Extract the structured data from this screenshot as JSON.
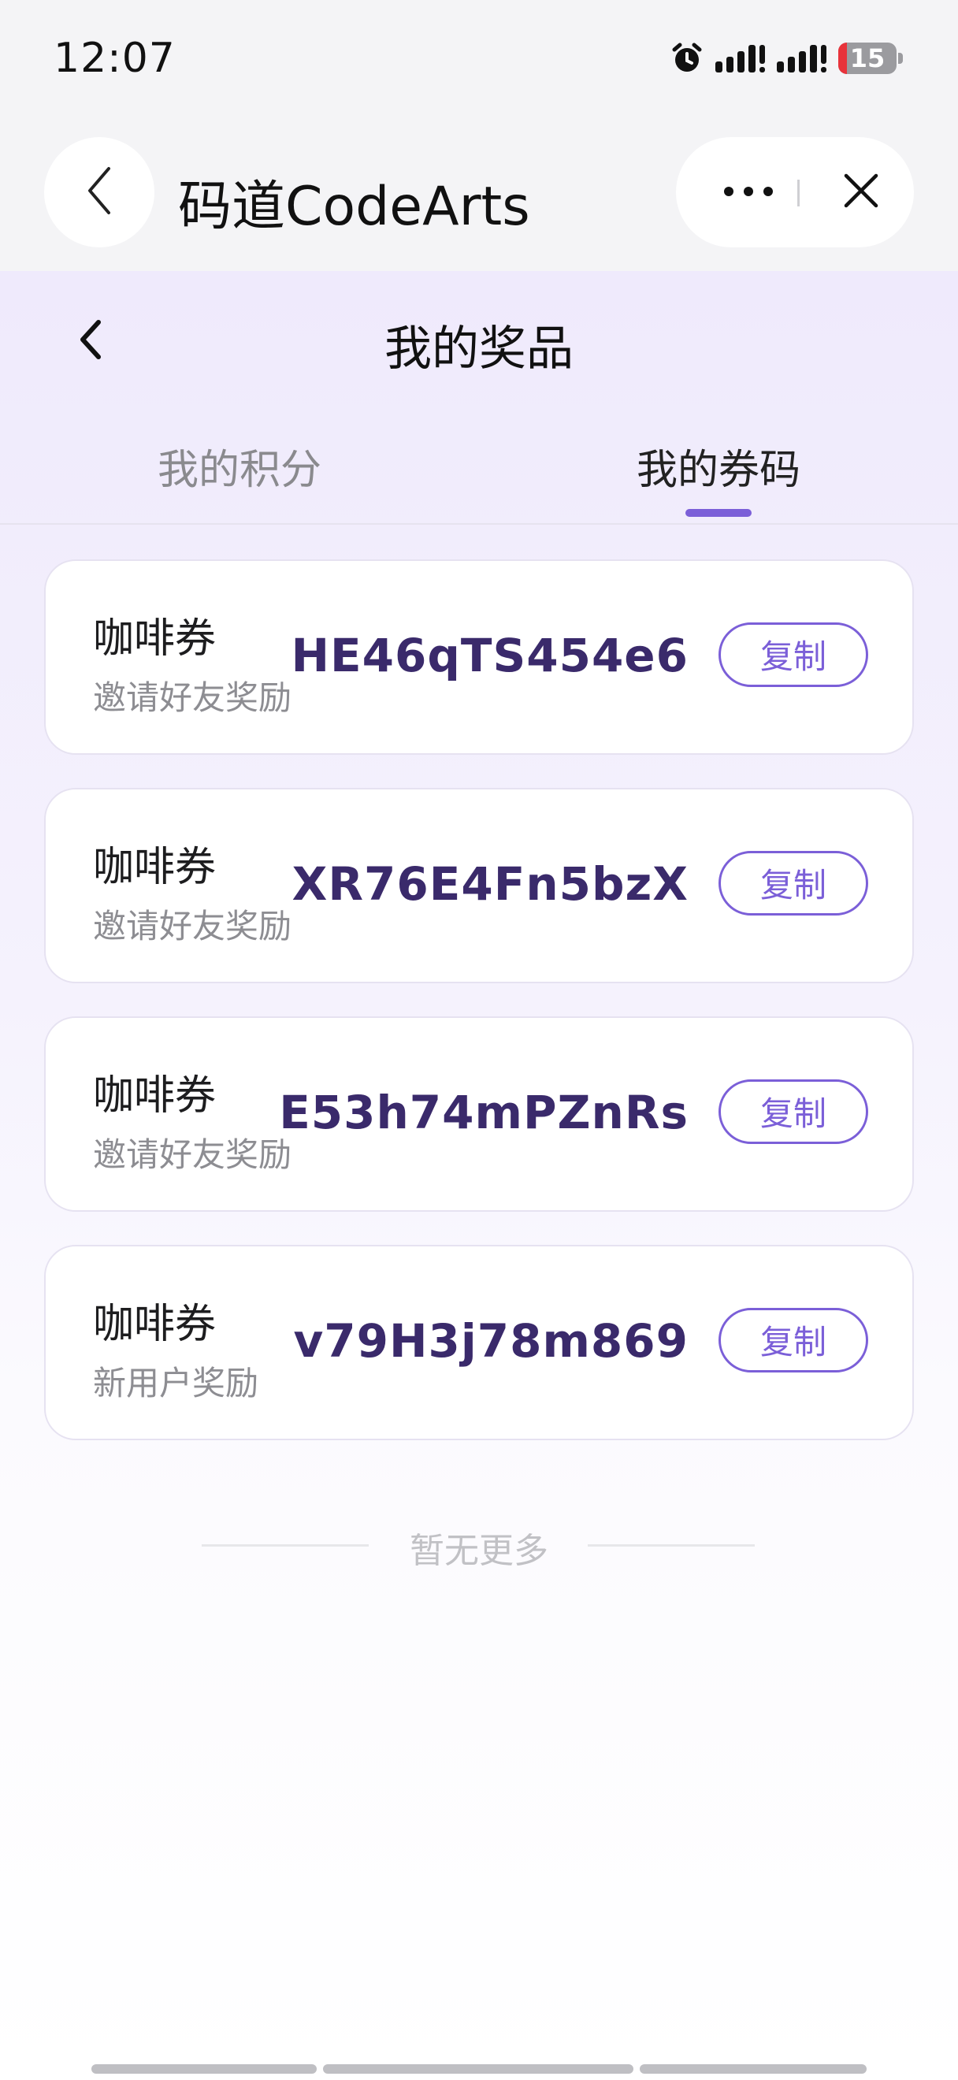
{
  "status_bar": {
    "time": "12:07",
    "battery_level": "15",
    "icons": [
      "alarm-icon",
      "signal-icon",
      "signal-icon",
      "battery-icon"
    ]
  },
  "mini_program": {
    "title": "码道CodeArts",
    "back_icon": "chevron-left-icon",
    "more_icon": "more-dots-icon",
    "close_icon": "close-icon"
  },
  "page": {
    "title": "我的奖品",
    "back_icon": "chevron-left-icon"
  },
  "tabs": [
    {
      "label": "我的积分",
      "active": false
    },
    {
      "label": "我的券码",
      "active": true
    }
  ],
  "coupons": [
    {
      "name": "咖啡券",
      "source": "邀请好友奖励",
      "code": "HE46qTS454e6",
      "action": "复制"
    },
    {
      "name": "咖啡券",
      "source": "邀请好友奖励",
      "code": "XR76E4Fn5bzX",
      "action": "复制"
    },
    {
      "name": "咖啡券",
      "source": "邀请好友奖励",
      "code": "E53h74mPZnRs",
      "action": "复制"
    },
    {
      "name": "咖啡券",
      "source": "新用户奖励",
      "code": "v79H3j78m869",
      "action": "复制"
    }
  ],
  "footer": {
    "no_more": "暂无更多"
  },
  "colors": {
    "accent": "#7b5fd8",
    "code_text": "#3a2a6b",
    "battery_low": "#e8333b"
  }
}
